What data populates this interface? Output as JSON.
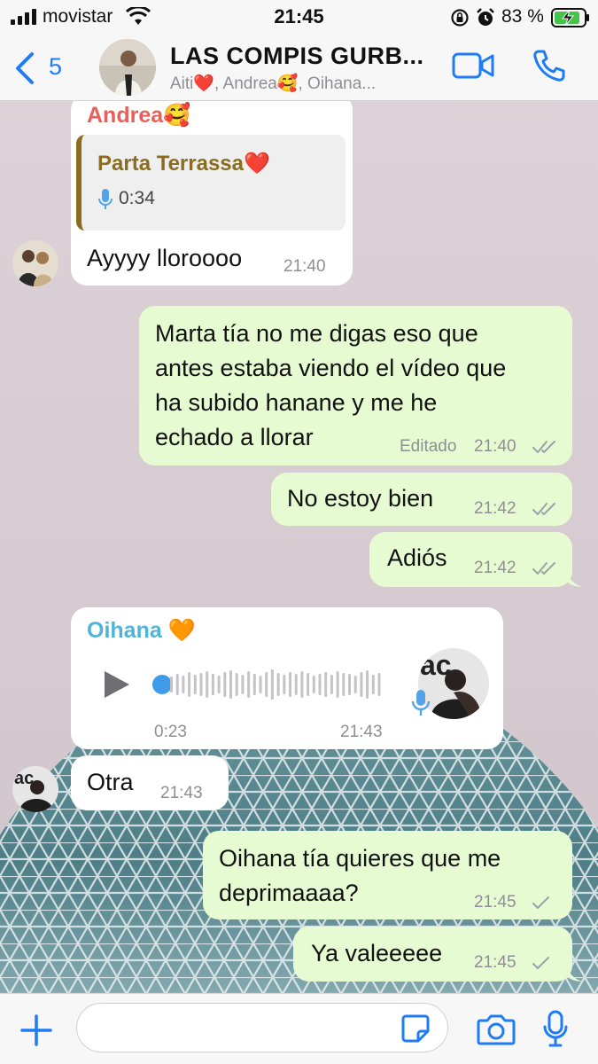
{
  "status_bar": {
    "carrier": "movistar",
    "time": "21:45",
    "battery": "83 %"
  },
  "header": {
    "back_count": "5",
    "title": "LAS  COMPIS GURB...",
    "subtitle": "Aiti❤️, Andrea🥰, Oihana..."
  },
  "messages": [
    {
      "direction": "in",
      "sender": "Andrea🥰",
      "quote": {
        "title": "Parta Terrassa❤️",
        "duration": "0:34"
      },
      "text": "Ayyyy lloroooo",
      "time": "21:40"
    },
    {
      "direction": "out",
      "lines": [
        "Marta tía no me digas eso que",
        "antes estaba viendo el vídeo que",
        "ha subido hanane y me he",
        "echado a llorar"
      ],
      "edited": "Editado",
      "time": "21:40",
      "status": "read"
    },
    {
      "direction": "out",
      "text": "No estoy bien",
      "time": "21:42",
      "status": "read"
    },
    {
      "direction": "out",
      "text": "Adiós",
      "time": "21:42",
      "status": "read"
    },
    {
      "direction": "in",
      "sender": "Oihana 🧡",
      "voice": {
        "elapsed": "0:23",
        "progress": 0.0
      },
      "time": "21:43"
    },
    {
      "direction": "in",
      "text": "Otra",
      "time": "21:43"
    },
    {
      "direction": "out",
      "lines": [
        "Oihana tía quieres que me",
        "deprimaaaa?"
      ],
      "time": "21:45",
      "status": "sent"
    },
    {
      "direction": "out",
      "text": "Ya valeeeee",
      "time": "21:45",
      "status": "sent"
    }
  ],
  "input": {
    "value": "",
    "placeholder": ""
  },
  "colors": {
    "accent": "#1f7cf5",
    "outgoing_bubble": "#e7fbd3",
    "incoming_bubble": "#ffffff",
    "andrea_name": "#e8605a",
    "oihana_name": "#4fb4d8",
    "quote_title": "#8a6d1f",
    "quote_bar": "#8a6d1f"
  }
}
